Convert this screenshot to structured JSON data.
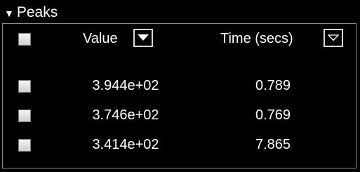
{
  "panel": {
    "title": "Peaks",
    "collapse_icon": "triangle-down-icon"
  },
  "table": {
    "columns": [
      {
        "label": "Value",
        "dropdown_icon": "dropdown-arrow-filled-icon"
      },
      {
        "label": "Time (secs)",
        "dropdown_icon": "dropdown-arrow-outline-icon"
      }
    ],
    "rows": [
      {
        "value": "3.944e+02",
        "time": "0.789",
        "checked": false
      },
      {
        "value": "3.746e+02",
        "time": "0.769",
        "checked": false
      },
      {
        "value": "3.414e+02",
        "time": "7.865",
        "checked": false
      }
    ]
  }
}
